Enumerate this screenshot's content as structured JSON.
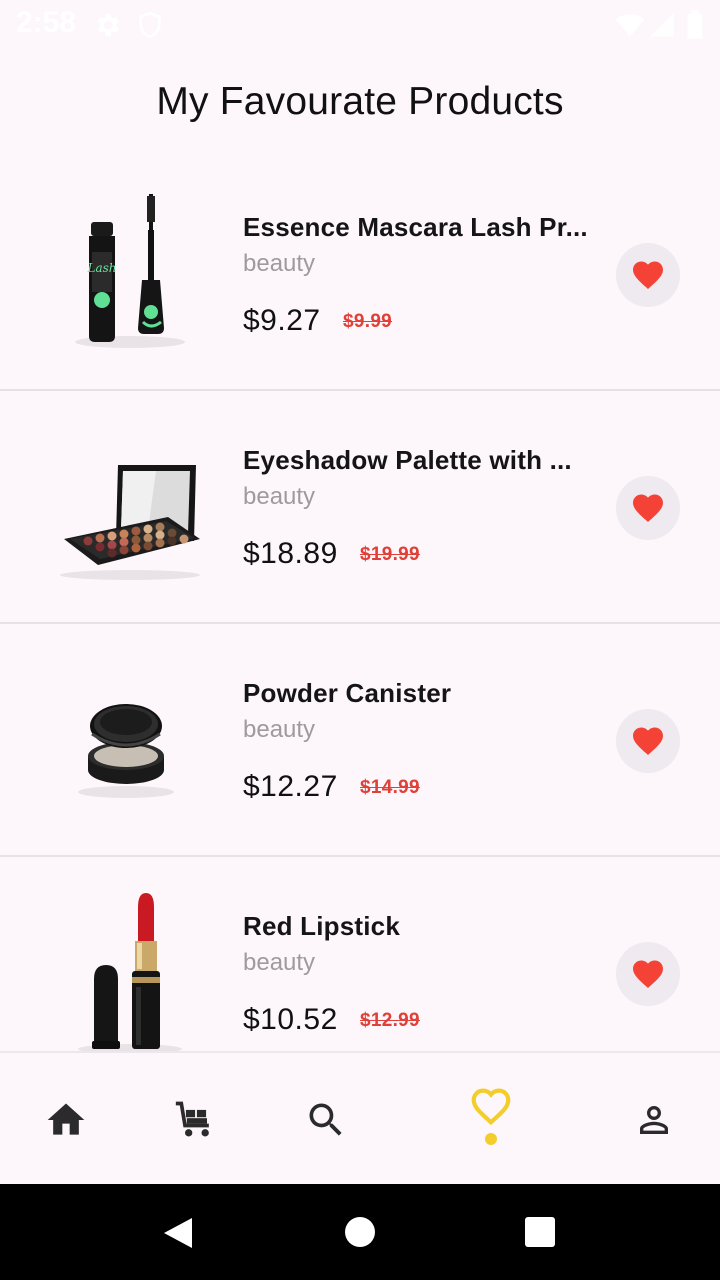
{
  "status_bar": {
    "time": "2:58"
  },
  "page": {
    "title": "My Favourate Products"
  },
  "products": [
    {
      "title": "Essence Mascara Lash Pr...",
      "category": "beauty",
      "price": "$9.27",
      "old_price": "$9.99",
      "image": "mascara"
    },
    {
      "title": "Eyeshadow Palette with ...",
      "category": "beauty",
      "price": "$18.89",
      "old_price": "$19.99",
      "image": "eyeshadow-palette"
    },
    {
      "title": "Powder Canister",
      "category": "beauty",
      "price": "$12.27",
      "old_price": "$14.99",
      "image": "powder-canister"
    },
    {
      "title": "Red Lipstick",
      "category": "beauty",
      "price": "$10.52",
      "old_price": "$12.99",
      "image": "lipstick"
    }
  ],
  "bottom_nav": {
    "items": [
      "home-icon",
      "cart-icon",
      "search-icon",
      "heart-outline-icon",
      "person-icon"
    ],
    "active": "heart-outline-icon"
  },
  "colors": {
    "accent": "#f3cd2c",
    "heart": "#f44336",
    "old_price": "#e04038",
    "background": "#fdf7fc"
  }
}
